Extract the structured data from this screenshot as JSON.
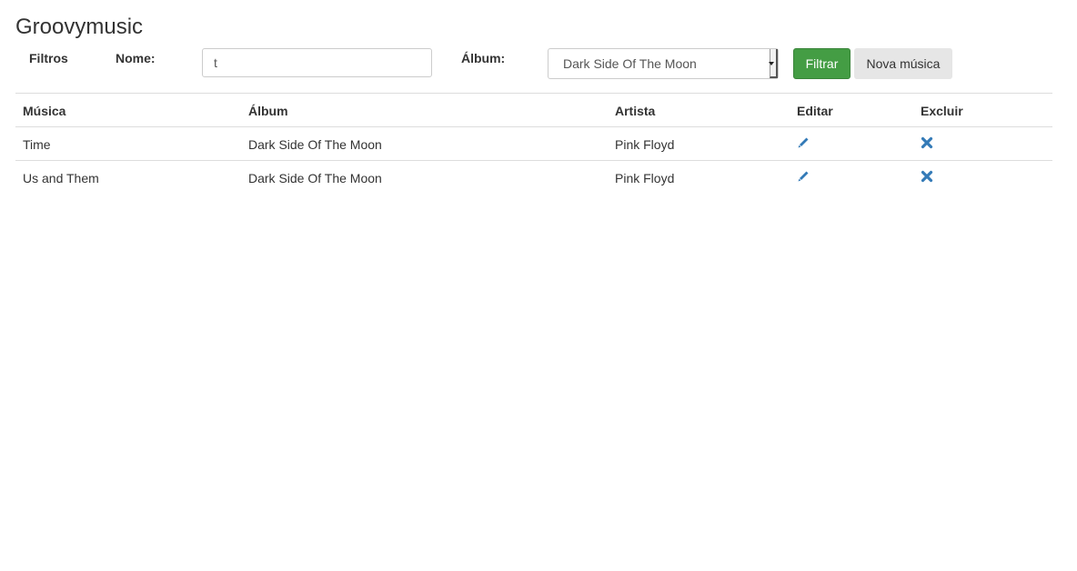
{
  "page": {
    "title": "Groovymusic"
  },
  "filters": {
    "section_label": "Filtros",
    "name_label": "Nome:",
    "name_value": "t",
    "album_label": "Álbum:",
    "album_selected": "Dark Side Of The Moon",
    "filter_button": "Filtrar",
    "new_button": "Nova música"
  },
  "table": {
    "headers": [
      "Música",
      "Álbum",
      "Artista",
      "Editar",
      "Excluir"
    ],
    "rows": [
      {
        "musica": "Time",
        "album": "Dark Side Of The Moon",
        "artista": "Pink Floyd"
      },
      {
        "musica": "Us and Them",
        "album": "Dark Side Of The Moon",
        "artista": "Pink Floyd"
      }
    ]
  },
  "colors": {
    "link_icon": "#337ab7",
    "primary_button": "#449d44"
  },
  "icons": {
    "edit": "pencil-icon",
    "delete": "remove-icon"
  }
}
